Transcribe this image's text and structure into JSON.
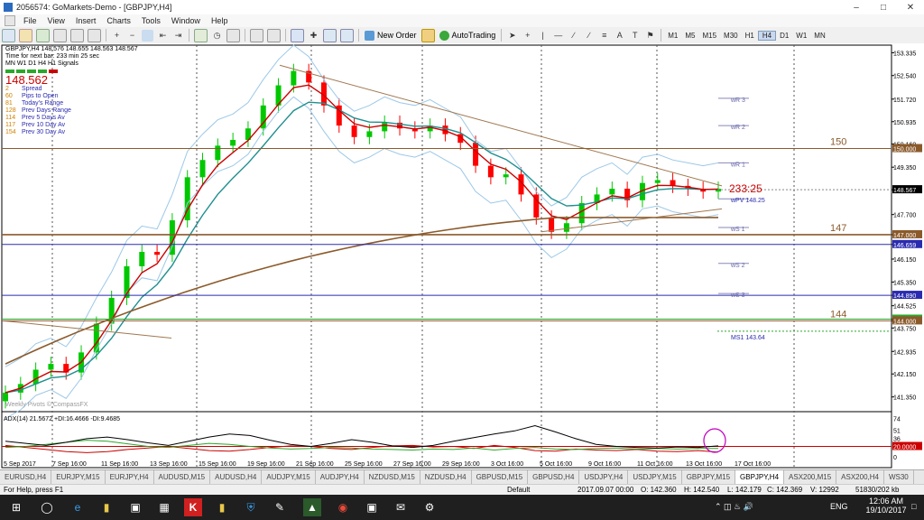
{
  "window": {
    "title": "2056574: GoMarkets-Demo - [GBPJPY,H4]",
    "controls": [
      "–",
      "□",
      "✕"
    ]
  },
  "menu": [
    "File",
    "View",
    "Insert",
    "Charts",
    "Tools",
    "Window",
    "Help"
  ],
  "toolbar": {
    "new_order": "New Order",
    "auto_trading": "AutoTrading",
    "timeframes": [
      "M1",
      "M5",
      "M15",
      "M30",
      "H1",
      "H4",
      "D1",
      "W1",
      "MN"
    ],
    "active_timeframe": "H4"
  },
  "chart": {
    "header": "GBPJPY,H4  148.576 148.655 148.563 148.567",
    "timer_line": "Time for next bar: 233 min 25 sec",
    "tf_row": "MN W1 D1 H4 H1 Signals",
    "price_big": "148.562",
    "stats": [
      {
        "value": "2",
        "label": "Spread"
      },
      {
        "value": "60",
        "label": "Pips to Open"
      },
      {
        "value": "81",
        "label": "Today's Range"
      },
      {
        "value": "128",
        "label": "Prev Days Range"
      },
      {
        "value": "114",
        "label": "Prev 5 Days Av"
      },
      {
        "value": "117",
        "label": "Prev 10 Day Av"
      },
      {
        "value": "154",
        "label": "Prev 30 Day Av"
      }
    ],
    "countdown": "233:25",
    "pivots": [
      {
        "label": "wR 3",
        "price": 151.75
      },
      {
        "label": "wR 2",
        "price": 150.8
      },
      {
        "label": "wR 1",
        "price": 149.5
      },
      {
        "label": "wPV  148.25",
        "price": 148.25
      },
      {
        "label": "wS 1",
        "price": 147.25
      },
      {
        "label": "wS 2",
        "price": 146.0
      },
      {
        "label": "wS 3",
        "price": 144.95
      }
    ],
    "ms1_label": "MS1  143.64",
    "level_labels": [
      {
        "text": "150",
        "price": 150.0
      },
      {
        "text": "147",
        "price": 147.0
      },
      {
        "text": "144",
        "price": 144.0
      }
    ],
    "watermark": "Weekly Pivots © CompassFX",
    "current_price": "148.567",
    "y_ticks": [
      "153.335",
      "152.540",
      "151.720",
      "150.935",
      "150.160",
      "149.350",
      "148.567",
      "147.700",
      "147.000",
      "146.659",
      "146.150",
      "145.350",
      "144.890",
      "144.525",
      "144.060",
      "144.000",
      "143.750",
      "142.935",
      "142.150",
      "141.350"
    ],
    "y_tick_values": [
      153.335,
      152.54,
      151.72,
      150.935,
      150.16,
      149.35,
      148.567,
      147.7,
      147.0,
      146.659,
      146.15,
      145.35,
      144.89,
      144.525,
      144.06,
      144.0,
      143.75,
      142.935,
      142.15,
      141.35
    ],
    "highlighted_ticks": [
      {
        "text": "150.000",
        "price": 150.0,
        "color": "#8b5a2b"
      },
      {
        "text": "148.567",
        "price": 148.567,
        "color": "#000000"
      },
      {
        "text": "147.000",
        "price": 147.0,
        "color": "#8b5a2b"
      },
      {
        "text": "146.659",
        "price": 146.659,
        "color": "#2b2bb0"
      },
      {
        "text": "144.890",
        "price": 144.89,
        "color": "#2b2bb0"
      },
      {
        "text": "144.060",
        "price": 144.06,
        "color": "#2aa82a"
      },
      {
        "text": "144.000",
        "price": 144.0,
        "color": "#8b5a2b"
      }
    ],
    "x_labels": [
      "5 Sep 2017",
      "7 Sep 16:00",
      "11 Sep 16:00",
      "13 Sep 16:00",
      "15 Sep 16:00",
      "19 Sep 16:00",
      "21 Sep 16:00",
      "25 Sep 16:00",
      "27 Sep 16:00",
      "29 Sep 16:00",
      "3 Oct 16:00",
      "5 Oct 16:00",
      "9 Oct 16:00",
      "11 Oct 16:00",
      "13 Oct 16:00",
      "17 Oct 16:00"
    ],
    "adx_header": "ADX(14) 21.5672 +DI:16.4666 -DI:9.4685",
    "adx_ticks": [
      "74",
      "51",
      "36",
      "20",
      "0"
    ],
    "adx_level": "20.0000",
    "colors": {
      "up": "#00c800",
      "down": "#ff0000",
      "ema_fast": "#cc0000",
      "ema_mid": "#1f8f8f",
      "ema_slow": "#8b5a2b",
      "bollinger": "#9cc8e8",
      "pivot": "#8888bb",
      "adx": "#000000",
      "plus_di": "#2aa82a",
      "minus_di": "#cc0000",
      "ellipse": "#c000c0"
    }
  },
  "chart_data": {
    "type": "candlestick",
    "symbol": "GBPJPY",
    "timeframe": "H4",
    "ylim": [
      140.9,
      153.6
    ],
    "x_range": [
      "5 Sep 2017",
      "17 Oct 2017"
    ],
    "close_path": [
      141.5,
      141.8,
      142.3,
      142.5,
      142.2,
      142.9,
      143.9,
      144.8,
      145.9,
      146.4,
      146.3,
      147.5,
      149.0,
      149.6,
      150.1,
      150.3,
      150.7,
      151.5,
      152.2,
      152.7,
      152.3,
      151.5,
      150.8,
      150.4,
      150.6,
      150.9,
      150.7,
      150.6,
      150.8,
      150.5,
      150.2,
      149.4,
      149.0,
      149.1,
      148.4,
      147.6,
      147.1,
      147.4,
      148.1,
      148.4,
      148.6,
      148.2,
      148.8,
      148.9,
      148.7,
      148.6,
      148.5,
      148.6
    ],
    "key_levels": [
      150.0,
      147.0,
      144.0
    ],
    "blue_levels": [
      146.659,
      144.89
    ],
    "current_price": 148.567,
    "indicators": {
      "ADX": 21.5672,
      "+DI": 16.4666,
      "-DI": 9.4685,
      "adx_level": 20.0
    },
    "adx_series": [
      30,
      26,
      22,
      28,
      35,
      38,
      33,
      27,
      22,
      30,
      38,
      44,
      41,
      32,
      24,
      20,
      26,
      33,
      28,
      21,
      18,
      22,
      30,
      37,
      44,
      50,
      60,
      48,
      35,
      24,
      20,
      18,
      17,
      19,
      18,
      21
    ],
    "plus_di_series": [
      18,
      20,
      24,
      28,
      32,
      30,
      25,
      20,
      18,
      22,
      26,
      24,
      20,
      17,
      15,
      16,
      18,
      17,
      15,
      14,
      13,
      15,
      14,
      17,
      13,
      16,
      18,
      15,
      14,
      16,
      17,
      15,
      16,
      15,
      16,
      16
    ],
    "minus_di_series": [
      22,
      18,
      14,
      10,
      8,
      10,
      14,
      17,
      20,
      16,
      12,
      11,
      14,
      18,
      21,
      20,
      16,
      14,
      18,
      21,
      22,
      19,
      20,
      16,
      22,
      18,
      12,
      11,
      15,
      13,
      12,
      14,
      11,
      10,
      12,
      9
    ]
  },
  "tabs": [
    "EURUSD,H4",
    "EURJPY,M15",
    "EURJPY,H4",
    "AUDUSD,M15",
    "AUDUSD,H4",
    "AUDJPY,M15",
    "AUDJPY,H4",
    "NZDUSD,M15",
    "NZDUSD,H4",
    "GBPUSD,M15",
    "GBPUSD,H4",
    "USDJPY,H4",
    "USDJPY,M15",
    "GBPJPY,M15",
    "GBPJPY,H4",
    "ASX200,M15",
    "ASX200,H4",
    "WS30"
  ],
  "active_tab": "GBPJPY,H4",
  "status": {
    "help": "For Help, press F1",
    "profile": "Default",
    "datetime": "2017.09.07 00:00",
    "open": "O: 142.360",
    "high": "H: 142.540",
    "low": "L: 142.179",
    "close": "C: 142.369",
    "volume": "V: 12992",
    "traffic": "51830/202 kb"
  },
  "taskbar": {
    "lang": "ENG",
    "time": "12:06 AM",
    "date": "19/10/2017"
  }
}
